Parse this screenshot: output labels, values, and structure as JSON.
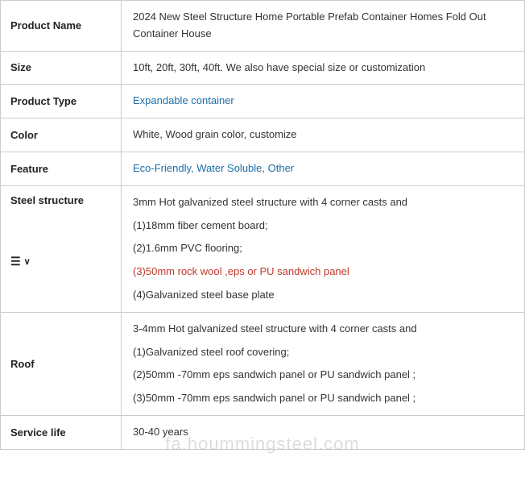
{
  "rows": [
    {
      "id": "product-name",
      "label": "Product Name",
      "value_lines": [
        {
          "text": "2024 New Steel Structure Home Portable Prefab Container Homes Fold Out Container House",
          "color": "black"
        }
      ]
    },
    {
      "id": "size",
      "label": "Size",
      "value_lines": [
        {
          "text": "10ft, 20ft,  30ft, 40ft.  We also have special size or customization",
          "color": "black"
        }
      ]
    },
    {
      "id": "product-type",
      "label": "Product Type",
      "value_lines": [
        {
          "text": "Expandable container",
          "color": "blue"
        }
      ]
    },
    {
      "id": "color",
      "label": "Color",
      "value_lines": [
        {
          "text": "White, Wood grain color, customize",
          "color": "black"
        }
      ]
    },
    {
      "id": "feature",
      "label": "Feature",
      "value_lines": [
        {
          "text": "Eco-Friendly, Water Soluble, Other",
          "color": "blue"
        }
      ]
    },
    {
      "id": "steel-structure",
      "label": "Steel structure",
      "has_icon": true,
      "value_lines": [
        {
          "text": "3mm Hot galvanized steel structure with 4 corner casts and",
          "color": "black"
        },
        {
          "text": "(1)18mm fiber cement board;",
          "color": "black"
        },
        {
          "text": "(2)1.6mm PVC flooring;",
          "color": "black"
        },
        {
          "text": "(3)50mm rock wool ,eps or PU sandwich panel",
          "color": "red"
        },
        {
          "text": "(4)Galvanized steel base plate",
          "color": "black"
        }
      ]
    },
    {
      "id": "roof",
      "label": "Roof",
      "value_lines": [
        {
          "text": "3-4mm Hot galvanized steel structure with 4 corner casts and",
          "color": "black"
        },
        {
          "text": "(1)Galvanized steel roof covering;",
          "color": "black"
        },
        {
          "text": "(2)50mm -70mm eps sandwich panel or PU sandwich panel ;",
          "color": "black"
        },
        {
          "text": "(3)50mm -70mm eps sandwich panel or PU sandwich panel ;",
          "color": "black"
        }
      ]
    },
    {
      "id": "service-life",
      "label": "Service life",
      "value_lines": [
        {
          "text": "30-40 years",
          "color": "black"
        }
      ]
    }
  ],
  "watermark": "fa.hoummingsteel.com"
}
